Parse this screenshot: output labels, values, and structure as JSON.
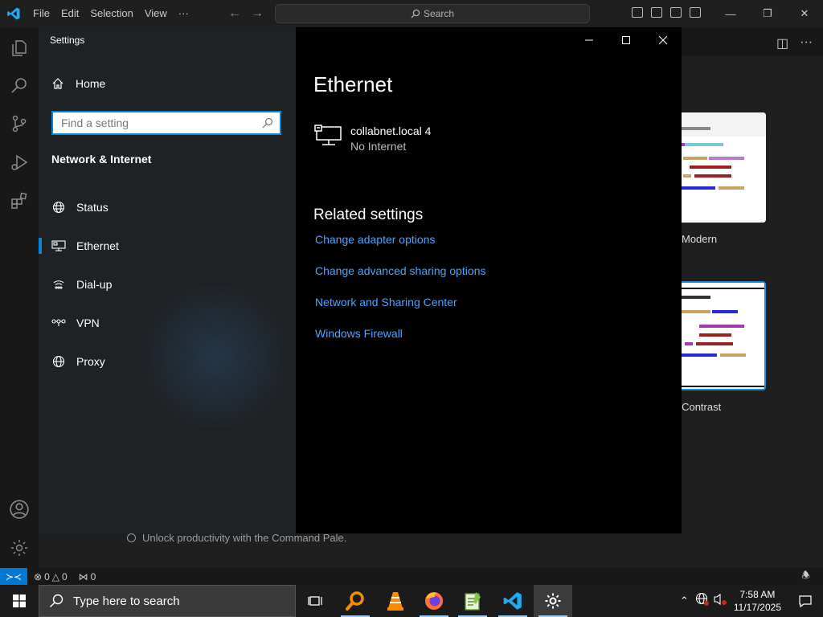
{
  "vscode": {
    "menu": [
      "File",
      "Edit",
      "Selection",
      "View",
      "···"
    ],
    "search_label": "Search",
    "theme_labels": [
      "Modern",
      "gh Contrast"
    ],
    "background_text": "Unlock productivity with the Command Pale.",
    "status": {
      "errors": "0",
      "warnings": "0",
      "ports": "0"
    }
  },
  "settings": {
    "window_title": "Settings",
    "home_label": "Home",
    "search_placeholder": "Find a setting",
    "section_title": "Network & Internet",
    "nav_items": [
      {
        "label": "Status",
        "icon": "globe-icon"
      },
      {
        "label": "Ethernet",
        "icon": "ethernet-icon"
      },
      {
        "label": "Dial-up",
        "icon": "dialup-icon"
      },
      {
        "label": "VPN",
        "icon": "vpn-icon"
      },
      {
        "label": "Proxy",
        "icon": "proxy-globe-icon"
      }
    ],
    "page_title": "Ethernet",
    "network": {
      "name": "collabnet.local 4",
      "status": "No Internet"
    },
    "related_heading": "Related settings",
    "related_links": [
      "Change adapter options",
      "Change advanced sharing options",
      "Network and Sharing Center",
      "Windows Firewall"
    ]
  },
  "taskbar": {
    "search_placeholder": "Type here to search",
    "apps": [
      "task-view",
      "search-everything",
      "vlc",
      "firefox",
      "notepad-plus-plus",
      "vscode",
      "settings"
    ],
    "time": "7:58 AM",
    "date": "11/17/2025"
  },
  "colors": {
    "accent": "#0a84d6",
    "link": "#4aa3ff",
    "vscode_blue": "#0078d4"
  }
}
